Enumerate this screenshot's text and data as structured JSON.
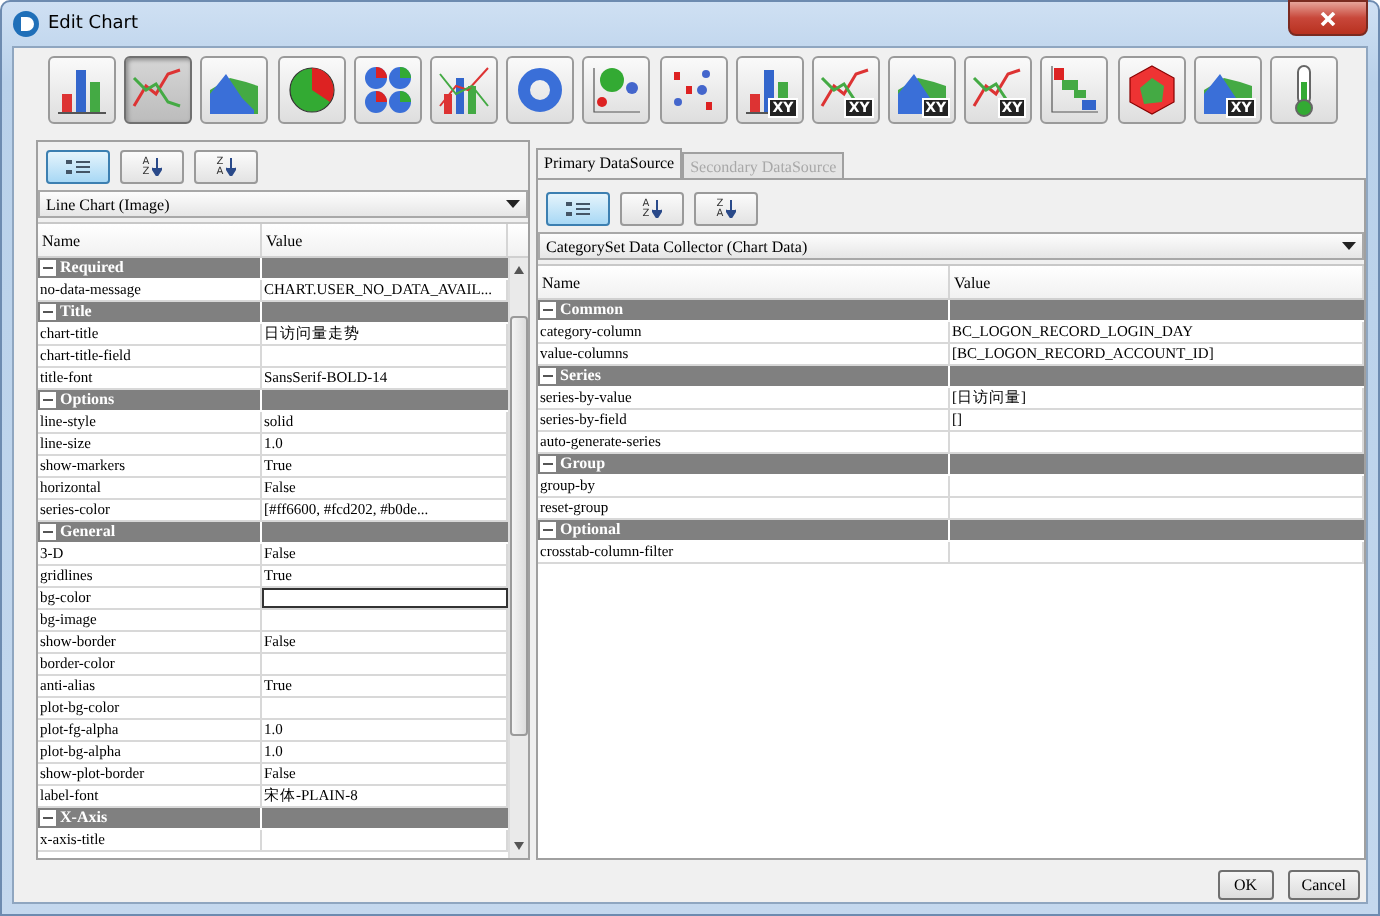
{
  "window": {
    "title": "Edit Chart"
  },
  "chart_types": [
    {
      "kind": "bar",
      "selected": false
    },
    {
      "kind": "line",
      "selected": true
    },
    {
      "kind": "area",
      "selected": false
    },
    {
      "kind": "pie",
      "selected": false
    },
    {
      "kind": "multipie",
      "selected": false
    },
    {
      "kind": "barline",
      "selected": false
    },
    {
      "kind": "donut",
      "selected": false
    },
    {
      "kind": "bubble",
      "selected": false
    },
    {
      "kind": "scatter",
      "selected": false
    },
    {
      "kind": "bar",
      "selected": false,
      "badge": "XY"
    },
    {
      "kind": "line",
      "selected": false,
      "badge": "XY"
    },
    {
      "kind": "area",
      "selected": false,
      "badge": "XY"
    },
    {
      "kind": "line",
      "selected": false,
      "badge": "XY"
    },
    {
      "kind": "step",
      "selected": false
    },
    {
      "kind": "radar",
      "selected": false
    },
    {
      "kind": "area",
      "selected": false,
      "badge": "XY"
    },
    {
      "kind": "thermometer",
      "selected": false
    }
  ],
  "left_panel": {
    "sort_buttons": [
      {
        "kind": "category",
        "selected": true
      },
      {
        "kind": "sort",
        "top": "A",
        "bottom": "Z",
        "selected": false
      },
      {
        "kind": "sort",
        "top": "Z",
        "bottom": "A",
        "selected": false
      }
    ],
    "dropdown": "Line Chart (Image)",
    "columns": [
      "Name",
      "Value"
    ],
    "rows": [
      {
        "kind": "group",
        "label": "Required"
      },
      {
        "kind": "property",
        "name": "no-data-message",
        "value": "CHART.USER_NO_DATA_AVAIL...",
        "editing": false
      },
      {
        "kind": "group",
        "label": "Title"
      },
      {
        "kind": "property",
        "name": "chart-title",
        "value": "日访问量走势",
        "editing": false
      },
      {
        "kind": "property",
        "name": "chart-title-field",
        "editing": false
      },
      {
        "kind": "property",
        "name": "title-font",
        "value": "SansSerif-BOLD-14",
        "editing": false
      },
      {
        "kind": "group",
        "label": "Options"
      },
      {
        "kind": "property",
        "name": "line-style",
        "value": "solid",
        "editing": false
      },
      {
        "kind": "property",
        "name": "line-size",
        "value": "1.0",
        "editing": false
      },
      {
        "kind": "property",
        "name": "show-markers",
        "value": "True",
        "editing": false
      },
      {
        "kind": "property",
        "name": "horizontal",
        "value": "False",
        "editing": false
      },
      {
        "kind": "property",
        "name": "series-color",
        "value": "[#ff6600, #fcd202, #b0de...",
        "editing": false
      },
      {
        "kind": "group",
        "label": "General"
      },
      {
        "kind": "property",
        "name": "3-D",
        "value": "False",
        "editing": false
      },
      {
        "kind": "property",
        "name": "gridlines",
        "value": "True",
        "editing": false
      },
      {
        "kind": "property",
        "name": "bg-color",
        "editing": true
      },
      {
        "kind": "property",
        "name": "bg-image",
        "editing": false
      },
      {
        "kind": "property",
        "name": "show-border",
        "value": "False",
        "editing": false
      },
      {
        "kind": "property",
        "name": "border-color",
        "editing": false
      },
      {
        "kind": "property",
        "name": "anti-alias",
        "value": "True",
        "editing": false
      },
      {
        "kind": "property",
        "name": "plot-bg-color",
        "editing": false
      },
      {
        "kind": "property",
        "name": "plot-fg-alpha",
        "value": "1.0",
        "editing": false
      },
      {
        "kind": "property",
        "name": "plot-bg-alpha",
        "value": "1.0",
        "editing": false
      },
      {
        "kind": "property",
        "name": "show-plot-border",
        "value": "False",
        "editing": false
      },
      {
        "kind": "property",
        "name": "label-font",
        "value": "宋体-PLAIN-8",
        "editing": false
      },
      {
        "kind": "group",
        "label": "X-Axis"
      },
      {
        "kind": "property",
        "name": "x-axis-title",
        "editing": false
      }
    ]
  },
  "right_panel": {
    "tabs": [
      {
        "label": "Primary DataSource",
        "selected": true,
        "disabled": false
      },
      {
        "label": "Secondary DataSource",
        "selected": false,
        "disabled": true
      }
    ],
    "sort_buttons": [
      {
        "kind": "category",
        "selected": true
      },
      {
        "kind": "sort",
        "top": "A",
        "bottom": "Z",
        "selected": false
      },
      {
        "kind": "sort",
        "top": "Z",
        "bottom": "A",
        "selected": false
      }
    ],
    "dropdown": "CategorySet Data Collector (Chart Data)",
    "columns": [
      "Name",
      "Value"
    ],
    "rows": [
      {
        "kind": "group",
        "label": "Common"
      },
      {
        "kind": "property",
        "name": "category-column",
        "value": "BC_LOGON_RECORD_LOGIN_DAY",
        "editing": false
      },
      {
        "kind": "property",
        "name": "value-columns",
        "value": "[BC_LOGON_RECORD_ACCOUNT_ID]",
        "editing": false
      },
      {
        "kind": "group",
        "label": "Series"
      },
      {
        "kind": "property",
        "name": "series-by-value",
        "value": "[日访问量]",
        "editing": false
      },
      {
        "kind": "property",
        "name": "series-by-field",
        "value": "[]",
        "editing": false
      },
      {
        "kind": "property",
        "name": "auto-generate-series",
        "editing": false
      },
      {
        "kind": "group",
        "label": "Group"
      },
      {
        "kind": "property",
        "name": "group-by",
        "editing": false
      },
      {
        "kind": "property",
        "name": "reset-group",
        "editing": false
      },
      {
        "kind": "group",
        "label": "Optional"
      },
      {
        "kind": "property",
        "name": "crosstab-column-filter",
        "editing": false
      }
    ]
  },
  "buttons": [
    "OK",
    "Cancel"
  ]
}
